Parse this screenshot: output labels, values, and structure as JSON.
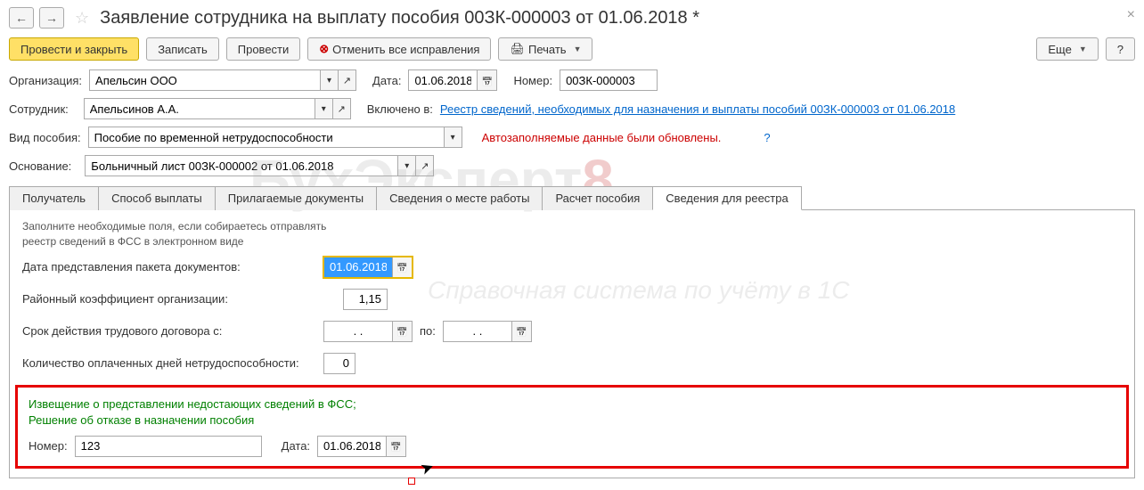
{
  "title": "Заявление сотрудника на выплату пособия 00ЗК-000003 от 01.06.2018 *",
  "toolbar": {
    "post_close": "Провести и закрыть",
    "save": "Записать",
    "post": "Провести",
    "cancel_fixes": "Отменить все исправления",
    "print": "Печать",
    "more": "Еще",
    "help": "?"
  },
  "org": {
    "label": "Организация:",
    "value": "Апельсин ООО"
  },
  "date": {
    "label": "Дата:",
    "value": "01.06.2018"
  },
  "number": {
    "label": "Номер:",
    "value": "00ЗК-000003"
  },
  "employee": {
    "label": "Сотрудник:",
    "value": "Апельсинов А.А."
  },
  "included": {
    "label": "Включено в:",
    "link": "Реестр сведений, необходимых для назначения и выплаты пособий 00ЗК-000003 от 01.06.2018"
  },
  "benefit_type": {
    "label": "Вид пособия:",
    "value": "Пособие по временной нетрудоспособности",
    "warn": "Автозаполняемые данные были обновлены."
  },
  "basis": {
    "label": "Основание:",
    "value": "Больничный лист 00ЗК-000002 от 01.06.2018"
  },
  "tabs": [
    "Получатель",
    "Способ выплаты",
    "Прилагаемые документы",
    "Сведения о месте работы",
    "Расчет пособия",
    "Сведения для реестра"
  ],
  "reg": {
    "hint1": "Заполните необходимые поля, если собираетесь отправлять",
    "hint2": "реестр сведений в ФСС в электронном виде",
    "pack_date_label": "Дата представления пакета документов:",
    "pack_date": "01.06.2018",
    "coef_label": "Районный коэффициент организации:",
    "coef": "1,15",
    "contract_label": "Срок действия трудового договора с:",
    "contract_from": ". .",
    "contract_to_lbl": "по:",
    "contract_to": ". .",
    "days_label": "Количество оплаченных дней нетрудоспособности:",
    "days": "0",
    "notice_line1": "Извещение о представлении недостающих сведений в ФСС;",
    "notice_line2": "Решение об отказе в назначении пособия",
    "notice_num_lbl": "Номер:",
    "notice_num": "123",
    "notice_date_lbl": "Дата:",
    "notice_date": "01.06.2018"
  }
}
